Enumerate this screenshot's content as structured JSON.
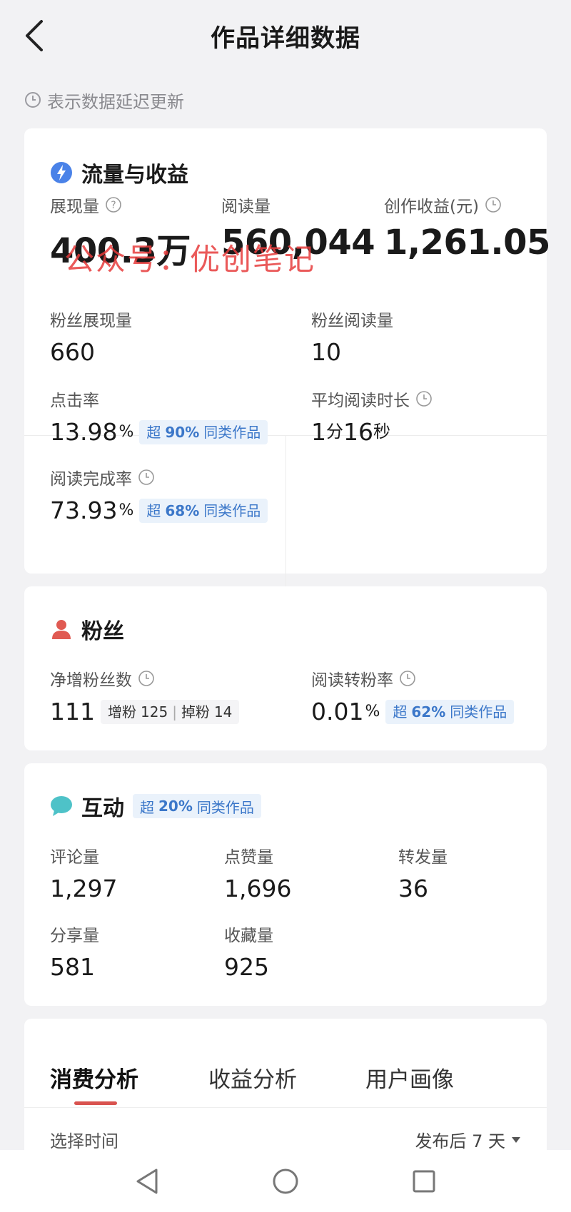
{
  "header": {
    "title": "作品详细数据"
  },
  "delay_note": "表示数据延迟更新",
  "watermark": "公众号：优创笔记",
  "traffic": {
    "title": "流量与收益",
    "kpis": [
      {
        "label": "展现量",
        "value": "400.3万"
      },
      {
        "label": "阅读量",
        "value": "560,044"
      },
      {
        "label": "创作收益(元)",
        "value": "1,261.05"
      }
    ],
    "fan_impressions": {
      "label": "粉丝展现量",
      "value": "660"
    },
    "fan_reads": {
      "label": "粉丝阅读量",
      "value": "10"
    },
    "ctr": {
      "label": "点击率",
      "value": "13.98",
      "unit": "%",
      "badge_prefix": "超",
      "badge_pct": "90%",
      "badge_suffix": "同类作品"
    },
    "avg_read_time": {
      "label": "平均阅读时长",
      "min": "1",
      "min_unit": "分",
      "sec": "16",
      "sec_unit": "秒"
    },
    "completion": {
      "label": "阅读完成率",
      "value": "73.93",
      "unit": "%",
      "badge_prefix": "超",
      "badge_pct": "68%",
      "badge_suffix": "同类作品"
    }
  },
  "fans": {
    "title": "粉丝",
    "net_gain": {
      "label": "净增粉丝数",
      "value": "111",
      "gain_label": "增粉",
      "gain": "125",
      "sep": "|",
      "loss_label": "掉粉",
      "loss": "14"
    },
    "conversion": {
      "label": "阅读转粉率",
      "value": "0.01",
      "unit": "%",
      "badge_prefix": "超",
      "badge_pct": "62%",
      "badge_suffix": "同类作品"
    }
  },
  "interaction": {
    "title": "互动",
    "badge_prefix": "超",
    "badge_pct": "20%",
    "badge_suffix": "同类作品",
    "items": [
      {
        "label": "评论量",
        "value": "1,297"
      },
      {
        "label": "点赞量",
        "value": "1,696"
      },
      {
        "label": "转发量",
        "value": "36"
      },
      {
        "label": "分享量",
        "value": "581"
      },
      {
        "label": "收藏量",
        "value": "925"
      }
    ]
  },
  "tabs": [
    "消费分析",
    "收益分析",
    "用户画像"
  ],
  "time_filter": {
    "label": "选择时间",
    "value": "发布后 7 天"
  },
  "colors": {
    "accent_red": "#d9534f",
    "badge_blue": "#3b77c9",
    "badge_bg": "#eaf2fb"
  }
}
